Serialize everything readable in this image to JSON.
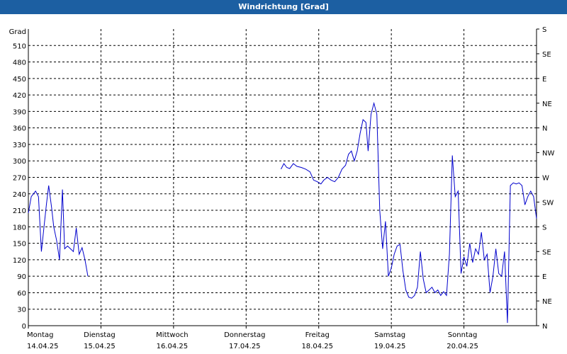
{
  "header": {
    "title": "Windrichtung [Grad]"
  },
  "chart_data": {
    "type": "line",
    "title": "Windrichtung [Grad]",
    "ylabel": "Grad",
    "ylim": [
      0,
      540
    ],
    "y_ticks": [
      0,
      30,
      60,
      90,
      120,
      150,
      180,
      210,
      240,
      270,
      300,
      330,
      360,
      390,
      420,
      450,
      480,
      510
    ],
    "y2_ticks": [
      {
        "value": 0,
        "label": "N"
      },
      {
        "value": 45,
        "label": "NE"
      },
      {
        "value": 90,
        "label": "E"
      },
      {
        "value": 135,
        "label": "SE"
      },
      {
        "value": 180,
        "label": "S"
      },
      {
        "value": 225,
        "label": "SW"
      },
      {
        "value": 270,
        "label": "W"
      },
      {
        "value": 315,
        "label": "NW"
      },
      {
        "value": 360,
        "label": "N"
      },
      {
        "value": 405,
        "label": "NE"
      },
      {
        "value": 450,
        "label": "E"
      },
      {
        "value": 495,
        "label": "SE"
      },
      {
        "value": 540,
        "label": "S"
      }
    ],
    "xlim": [
      0,
      7
    ],
    "x_ticks": [
      {
        "day": "Montag",
        "date": "14.04.25",
        "value": 0
      },
      {
        "day": "Dienstag",
        "date": "15.04.25",
        "value": 1
      },
      {
        "day": "Mittwoch",
        "date": "16.04.25",
        "value": 2
      },
      {
        "day": "Donnerstag",
        "date": "17.04.25",
        "value": 3
      },
      {
        "day": "Freitag",
        "date": "18.04.25",
        "value": 4
      },
      {
        "day": "Samstag",
        "date": "19.04.25",
        "value": 5
      },
      {
        "day": "Sonntag",
        "date": "20.04.25",
        "value": 6
      }
    ],
    "grid": true,
    "line_color": "#0000cc",
    "series": [
      {
        "segments": [
          [
            [
              0.0,
              205
            ],
            [
              0.04,
              235
            ],
            [
              0.1,
              245
            ],
            [
              0.14,
              235
            ],
            [
              0.18,
              135
            ],
            [
              0.22,
              185
            ],
            [
              0.25,
              222
            ],
            [
              0.28,
              255
            ],
            [
              0.32,
              215
            ],
            [
              0.35,
              180
            ],
            [
              0.39,
              155
            ],
            [
              0.43,
              120
            ],
            [
              0.47,
              248
            ],
            [
              0.5,
              140
            ],
            [
              0.54,
              145
            ],
            [
              0.58,
              140
            ],
            [
              0.62,
              135
            ],
            [
              0.66,
              178
            ],
            [
              0.7,
              130
            ],
            [
              0.74,
              142
            ],
            [
              0.78,
              120
            ],
            [
              0.82,
              90
            ]
          ],
          [
            [
              3.48,
              285
            ],
            [
              3.52,
              295
            ],
            [
              3.56,
              288
            ],
            [
              3.6,
              286
            ],
            [
              3.65,
              295
            ],
            [
              3.7,
              290
            ],
            [
              3.76,
              288
            ],
            [
              3.82,
              285
            ],
            [
              3.88,
              280
            ],
            [
              3.93,
              265
            ],
            [
              3.98,
              262
            ],
            [
              4.03,
              258
            ],
            [
              4.07,
              265
            ],
            [
              4.12,
              270
            ],
            [
              4.17,
              265
            ],
            [
              4.22,
              262
            ],
            [
              4.27,
              270
            ],
            [
              4.32,
              285
            ],
            [
              4.37,
              292
            ],
            [
              4.41,
              312
            ],
            [
              4.45,
              318
            ],
            [
              4.49,
              300
            ],
            [
              4.53,
              318
            ],
            [
              4.57,
              350
            ],
            [
              4.61,
              375
            ],
            [
              4.65,
              370
            ],
            [
              4.68,
              318
            ],
            [
              4.72,
              385
            ],
            [
              4.76,
              405
            ],
            [
              4.8,
              385
            ],
            [
              4.84,
              210
            ],
            [
              4.88,
              140
            ],
            [
              4.92,
              190
            ],
            [
              4.96,
              90
            ],
            [
              5.0,
              105
            ],
            [
              5.04,
              130
            ],
            [
              5.08,
              145
            ],
            [
              5.12,
              148
            ],
            [
              5.16,
              100
            ],
            [
              5.2,
              65
            ],
            [
              5.24,
              52
            ],
            [
              5.28,
              50
            ],
            [
              5.32,
              55
            ],
            [
              5.36,
              70
            ],
            [
              5.4,
              135
            ],
            [
              5.44,
              85
            ],
            [
              5.48,
              60
            ],
            [
              5.52,
              65
            ],
            [
              5.56,
              70
            ],
            [
              5.6,
              60
            ],
            [
              5.64,
              65
            ],
            [
              5.68,
              55
            ],
            [
              5.72,
              62
            ],
            [
              5.76,
              55
            ],
            [
              5.8,
              130
            ],
            [
              5.84,
              310
            ],
            [
              5.88,
              235
            ],
            [
              5.92,
              245
            ],
            [
              5.96,
              95
            ],
            [
              6.0,
              125
            ],
            [
              6.04,
              108
            ],
            [
              6.08,
              150
            ],
            [
              6.12,
              115
            ],
            [
              6.16,
              140
            ],
            [
              6.2,
              130
            ],
            [
              6.24,
              170
            ],
            [
              6.28,
              120
            ],
            [
              6.32,
              130
            ],
            [
              6.36,
              60
            ],
            [
              6.4,
              90
            ],
            [
              6.44,
              140
            ],
            [
              6.48,
              95
            ],
            [
              6.52,
              90
            ],
            [
              6.56,
              135
            ],
            [
              6.6,
              5
            ],
            [
              6.64,
              255
            ],
            [
              6.68,
              260
            ],
            [
              6.72,
              258
            ],
            [
              6.76,
              260
            ],
            [
              6.8,
              255
            ],
            [
              6.84,
              220
            ],
            [
              6.88,
              235
            ],
            [
              6.92,
              245
            ],
            [
              6.96,
              235
            ],
            [
              7.0,
              195
            ]
          ]
        ]
      }
    ]
  }
}
